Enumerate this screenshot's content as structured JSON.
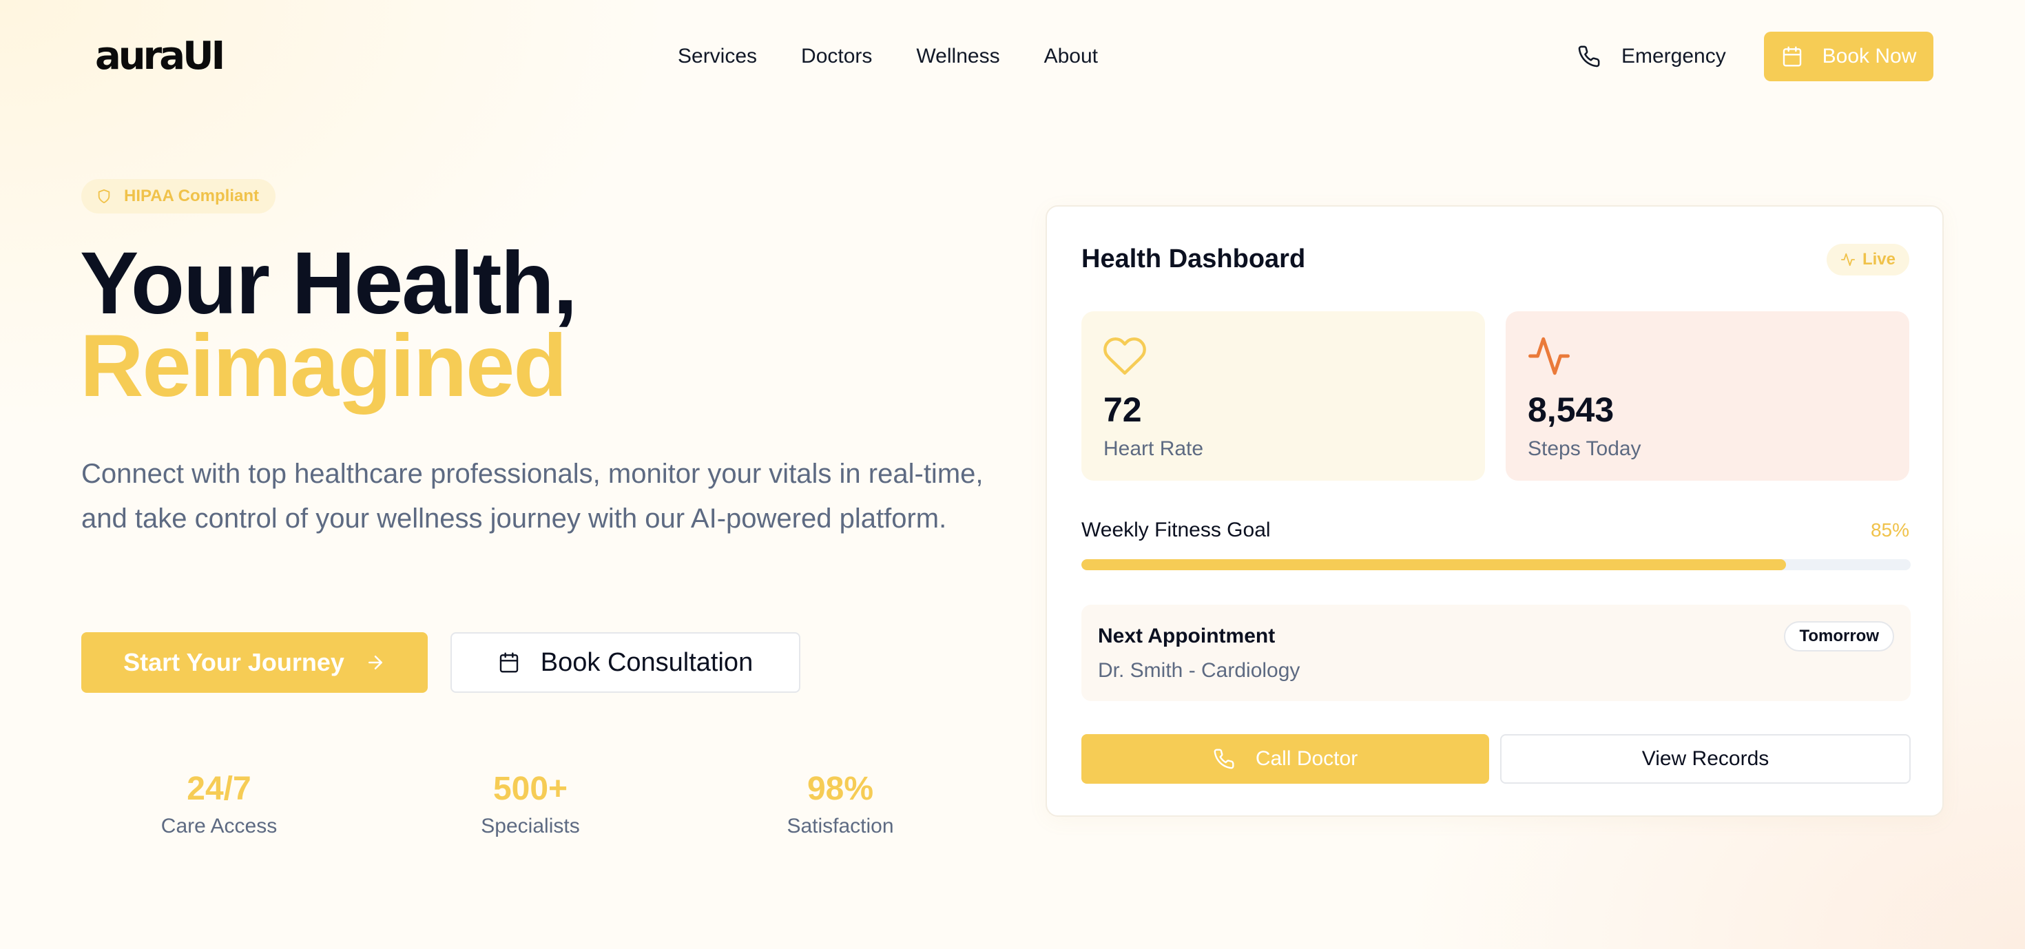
{
  "brand": {
    "logo": "auraUI"
  },
  "nav": {
    "links": [
      "Services",
      "Doctors",
      "Wellness",
      "About"
    ],
    "emergency_label": "Emergency",
    "book_now_label": "Book Now"
  },
  "hero": {
    "badge": "HIPAA Compliant",
    "headline_line1": "Your Health,",
    "headline_line2": "Reimagined",
    "subtext": "Connect with top healthcare professionals, monitor your vitals in real-time, and take control of your wellness journey with our AI-powered platform.",
    "primary_cta": "Start Your Journey",
    "secondary_cta": "Book Consultation",
    "stats": [
      {
        "value": "24/7",
        "label": "Care Access"
      },
      {
        "value": "500+",
        "label": "Specialists"
      },
      {
        "value": "98%",
        "label": "Satisfaction"
      }
    ]
  },
  "dashboard": {
    "title": "Health Dashboard",
    "live_label": "Live",
    "heart_rate": {
      "value": "72",
      "label": "Heart Rate"
    },
    "steps": {
      "value": "8,543",
      "label": "Steps Today"
    },
    "goal": {
      "label": "Weekly Fitness Goal",
      "percent_text": "85%",
      "progress": 0.85
    },
    "appointment": {
      "title": "Next Appointment",
      "detail": "Dr. Smith - Cardiology",
      "tag": "Tomorrow"
    },
    "call_doctor_label": "Call Doctor",
    "view_records_label": "View Records"
  },
  "colors": {
    "accent": "#f6cc55",
    "accent_text": "#f0c24a",
    "heading": "#0b1020",
    "muted": "#5d6a82",
    "steps_icon": "#ea7a3a"
  },
  "icons": {
    "phone": "phone-icon",
    "calendar": "calendar-icon",
    "shield": "shield-icon",
    "activity": "activity-icon",
    "heart": "heart-icon",
    "arrow": "arrow-right-icon"
  }
}
